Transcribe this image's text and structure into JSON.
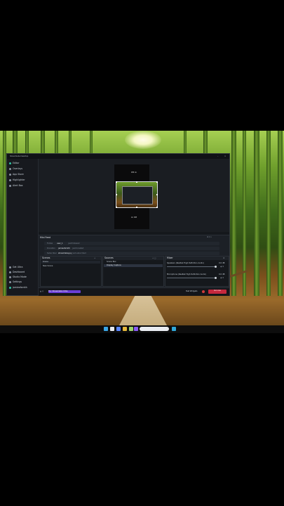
{
  "window": {
    "title": "Streamlabs Desktop"
  },
  "sidebar": {
    "items": [
      {
        "label": "Editor"
      },
      {
        "label": "Overlays"
      },
      {
        "label": "App Store"
      },
      {
        "label": "Highlighter"
      },
      {
        "label": "Alert Box"
      }
    ],
    "bottom_items": [
      {
        "label": "Get Ultra"
      },
      {
        "label": "Dashboard"
      },
      {
        "label": "Studio Mode"
      },
      {
        "label": "Settings"
      },
      {
        "label": "jamieafsmith"
      }
    ]
  },
  "preview": {
    "top_label": "DM Lk",
    "bottom_label": "Lk DM"
  },
  "feed": {
    "title": "Mini Feed",
    "rows": [
      {
        "label": "Follow",
        "value": "user_1",
        "note": "just followed"
      },
      {
        "label": "Donation",
        "value": "jamieafsmith",
        "note": "just donated"
      },
      {
        "label": "Subscriber",
        "value": "streamlabsguy",
        "note": "just subscribed"
      }
    ]
  },
  "scenes": {
    "title": "Scenes",
    "header": "Scene",
    "items": [
      "New Scene"
    ]
  },
  "sources": {
    "title": "Sources",
    "items": [
      "Scene Box",
      "Display Capture"
    ]
  },
  "mixer": {
    "title": "Mixer",
    "channels": [
      {
        "name": "Speakers (Realtek High Definition Audio)",
        "db": "0.0 dB",
        "level": 0.82
      },
      {
        "name": "Microphone (Realtek High Definition Audio)",
        "db": "0.0 dB",
        "level": 0.82
      }
    ]
  },
  "statusbar": {
    "notice": "Tip: Streamlabs Ultra",
    "test_widgets": "Test Widgets",
    "go_live": "Go Live"
  },
  "colors": {
    "accent": "#31c3a2",
    "go_live": "#c5283d",
    "notice": "#6a3fd6"
  }
}
